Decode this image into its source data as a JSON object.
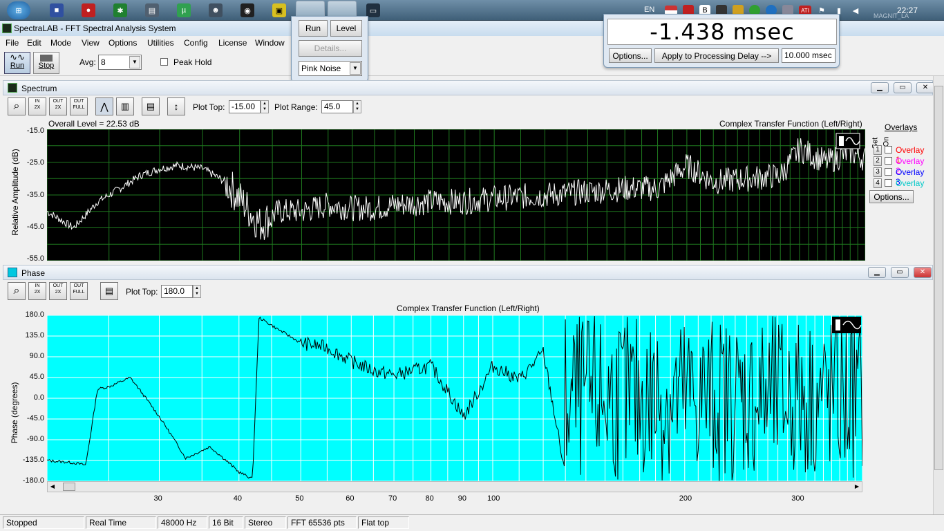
{
  "taskbar": {
    "lang": "EN",
    "clock": "22:27",
    "watermark": "MAGNIT_LA"
  },
  "window": {
    "title": "SpectraLAB - FFT Spectral Analysis System"
  },
  "menu": [
    "File",
    "Edit",
    "Mode",
    "View",
    "Options",
    "Utilities",
    "Config",
    "License",
    "Window"
  ],
  "toolbar": {
    "run_label": "Run",
    "stop_label": "Stop",
    "avg_label": "Avg:",
    "avg_value": "8",
    "peak_hold_label": "Peak Hold"
  },
  "run_panel": {
    "run_label": "Run",
    "level_label": "Level",
    "details_label": "Details...",
    "generator_value": "Pink Noise"
  },
  "delay_panel": {
    "value": "-1.438 msec",
    "options_label": "Options...",
    "apply_label": "Apply to Processing Delay -->",
    "delay_value": "10.000 msec"
  },
  "spectrum": {
    "title": "Spectrum",
    "plot_top_label": "Plot Top:",
    "plot_top_value": "-15.00",
    "plot_range_label": "Plot Range:",
    "plot_range_value": "45.0",
    "overall_level": "Overall Level = 22.53 dB",
    "chart_title": "Complex Transfer Function (Left/Right)",
    "ylabel": "Relative Amplitude (dB)",
    "yticks": [
      "-15.0",
      "-25.0",
      "-35.0",
      "-45.0",
      "-55.0"
    ],
    "overlays_title": "Overlays",
    "set_label": "Set",
    "on_label": "On",
    "overlays": [
      {
        "num": "1",
        "label": "Overlay 1",
        "color": "#ff0000"
      },
      {
        "num": "2",
        "label": "Overlay 2",
        "color": "#ff00ff"
      },
      {
        "num": "3",
        "label": "Overlay 3",
        "color": "#0000ff"
      },
      {
        "num": "4",
        "label": "Overlay 4",
        "color": "#00c8c8"
      }
    ],
    "options_label": "Options...",
    "bg_color": "#000000",
    "trace_color": "#ffffff",
    "grid_color": "#1f7a1f"
  },
  "phase": {
    "title": "Phase",
    "plot_top_label": "Plot Top:",
    "plot_top_value": "180.0",
    "chart_title": "Complex Transfer Function (Left/Right)",
    "ylabel": "Phase (degrees)",
    "yticks": [
      "180.0",
      "135.0",
      "90.0",
      "45.0",
      "0.0",
      "-45.0",
      "-90.0",
      "-135.0",
      "-180.0"
    ],
    "xticks": [
      "30",
      "40",
      "50",
      "60",
      "70",
      "80",
      "90",
      "100",
      "200",
      "300"
    ],
    "bg_color": "#00ffff",
    "trace_color": "#000000"
  },
  "chart_data": [
    {
      "type": "line",
      "title": "Complex Transfer Function (Left/Right)",
      "ylabel": "Relative Amplitude (dB)",
      "xlabel": "",
      "ylim": [
        -55,
        -15
      ],
      "x_scale": "log",
      "x": [
        20,
        22,
        24,
        26,
        28,
        30,
        32,
        35,
        38,
        40,
        43,
        46,
        50,
        55,
        60,
        65,
        70,
        80,
        90,
        100,
        120,
        140,
        160,
        180,
        200,
        220,
        250,
        280,
        300,
        330,
        360,
        380
      ],
      "series": [
        {
          "values": [
            -40,
            -45,
            -37,
            -33,
            -29,
            -27,
            -26,
            -27,
            -31,
            -36,
            -44,
            -40,
            -40,
            -38,
            -39,
            -39,
            -38,
            -37,
            -37,
            -36,
            -35,
            -34,
            -33,
            -33,
            -26,
            -31,
            -30,
            -29,
            -21,
            -25,
            -22,
            -24
          ]
        }
      ]
    },
    {
      "type": "line",
      "title": "Complex Transfer Function (Left/Right)",
      "ylabel": "Phase (degrees)",
      "xlabel": "",
      "ylim": [
        -180,
        180
      ],
      "x_scale": "log",
      "x": [
        20,
        22,
        23,
        24,
        25,
        27,
        30,
        33,
        36,
        40,
        42,
        43,
        46,
        50,
        55,
        60,
        65,
        70,
        80,
        90,
        100,
        110,
        120,
        130,
        140,
        160,
        180,
        200,
        250,
        300,
        350
      ],
      "series": [
        {
          "values": [
            -135,
            -140,
            -145,
            20,
            25,
            45,
            -40,
            -130,
            -105,
            -160,
            -175,
            175,
            150,
            120,
            110,
            80,
            60,
            50,
            70,
            -40,
            70,
            40,
            100,
            -170,
            170,
            -170,
            170,
            -170,
            170,
            -170,
            0
          ]
        }
      ]
    }
  ],
  "statusbar": [
    "Stopped",
    "Real Time",
    "48000 Hz",
    "16 Bit",
    "Stereo",
    "FFT 65536 pts",
    "Flat top"
  ]
}
